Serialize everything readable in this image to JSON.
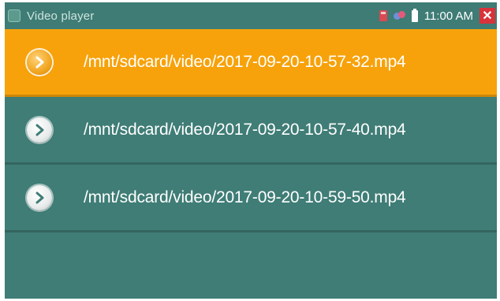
{
  "titlebar": {
    "app_title": "Video player",
    "clock": "11:00 AM",
    "close_symbol": "✕",
    "icons": [
      "app-icon",
      "sd-card-icon",
      "usb-icon",
      "battery-icon",
      "close-icon"
    ]
  },
  "files": [
    {
      "name": "/mnt/sdcard/video/2017-09-20-10-57-32.mp4",
      "selected": true
    },
    {
      "name": "/mnt/sdcard/video/2017-09-20-10-57-40.mp4",
      "selected": false
    },
    {
      "name": "/mnt/sdcard/video/2017-09-20-10-59-50.mp4",
      "selected": false
    }
  ],
  "colors": {
    "background": "#3f7d76",
    "selected_row": "#f7a20b",
    "close_button": "#d9323a"
  }
}
